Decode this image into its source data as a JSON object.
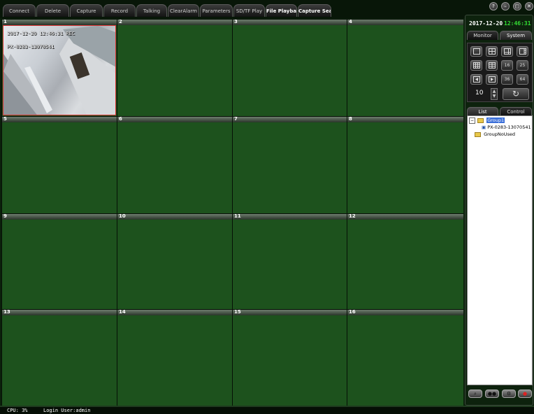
{
  "tabs": [
    "Connect",
    "Delete",
    "Capture",
    "Record",
    "Talking",
    "ClearAlarm",
    "Parameters",
    "SD/TF Play",
    "File Playback",
    "Capture Search"
  ],
  "window_buttons": [
    "?",
    "–",
    "□",
    "✕"
  ],
  "cells": [
    "1",
    "2",
    "3",
    "4",
    "5",
    "6",
    "7",
    "8",
    "9",
    "10",
    "11",
    "12",
    "13",
    "14",
    "15",
    "16"
  ],
  "video": {
    "timestamp": "2017-12-20  12:46:31  REC",
    "camera_id": "PX-0283-13070541"
  },
  "panel": {
    "date": "2017-12-20",
    "time": "12:46:31",
    "tab_monitor": "Monitor",
    "tab_system": "System",
    "layout_labels": [
      "16",
      "25",
      "36",
      "64"
    ],
    "spin_value": "10",
    "tab_list": "List",
    "tab_control": "Control",
    "tree": {
      "group1": "Group1",
      "device": "PX-0283-13070541",
      "group_unused": "GroupNoUsed"
    }
  },
  "status": {
    "cpu": "CPU: 3%",
    "login": "Login User:admin"
  },
  "colors": {
    "cell_bg": "#1d521d",
    "time_green": "#33dd33",
    "active_border": "#dd3333"
  }
}
